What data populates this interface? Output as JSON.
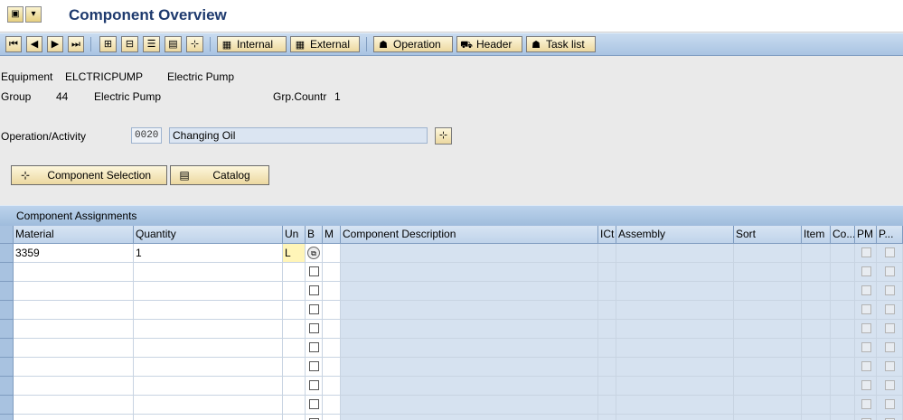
{
  "window": {
    "title": "Component Overview"
  },
  "titlebar_icons": [
    "menu-icon",
    "customize-icon"
  ],
  "toolbar": {
    "nav": [
      "first-page-icon",
      "previous-page-icon",
      "next-page-icon",
      "last-page-icon"
    ],
    "tools": [
      "select-block-icon",
      "deselect-icon",
      "details-icon",
      "list-icon",
      "hierarchy-icon"
    ],
    "internal_label": "Internal",
    "external_label": "External",
    "operation_label": "Operation",
    "header_label": "Header",
    "task_list_label": "Task list"
  },
  "header_fields": {
    "equipment_label": "Equipment",
    "equipment_value": "ELCTRICPUMP",
    "equipment_desc": "Electric Pump",
    "group_label": "Group",
    "group_value": "44",
    "group_desc": "Electric Pump",
    "grp_counter_label": "Grp.Countr",
    "grp_counter_value": "1"
  },
  "operation": {
    "label": "Operation/Activity",
    "number": "0020",
    "description": "Changing Oil"
  },
  "buttons": {
    "component_selection": "Component Selection",
    "catalog": "Catalog"
  },
  "table": {
    "title": "Component Assignments",
    "columns": [
      "Material",
      "Quantity",
      "Un",
      "B",
      "M",
      "Component Description",
      "ICt",
      "Assembly",
      "Sort",
      "Item",
      "Co...",
      "PM",
      "P..."
    ],
    "rows": [
      {
        "material": "3359",
        "quantity": "1",
        "unit": "L"
      },
      {
        "material": "",
        "quantity": "",
        "unit": ""
      },
      {
        "material": "",
        "quantity": "",
        "unit": ""
      },
      {
        "material": "",
        "quantity": "",
        "unit": ""
      },
      {
        "material": "",
        "quantity": "",
        "unit": ""
      },
      {
        "material": "",
        "quantity": "",
        "unit": ""
      },
      {
        "material": "",
        "quantity": "",
        "unit": ""
      },
      {
        "material": "",
        "quantity": "",
        "unit": ""
      },
      {
        "material": "",
        "quantity": "",
        "unit": ""
      },
      {
        "material": "",
        "quantity": "",
        "unit": ""
      }
    ]
  },
  "colors": {
    "title": "#1e3a6e",
    "toolbar": "#a9c4e2",
    "button": "#ecd8a0",
    "input_cell": "#d6e2f0"
  }
}
